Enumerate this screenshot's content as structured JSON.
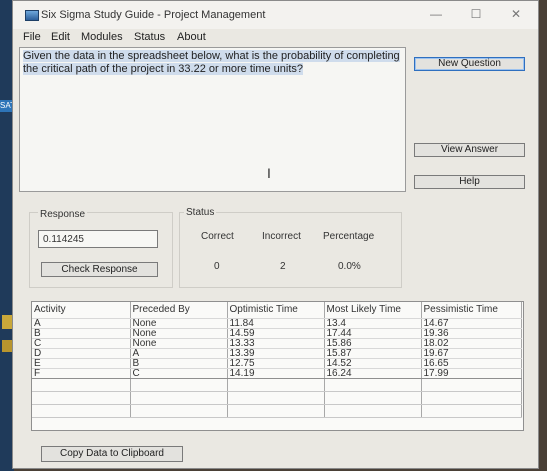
{
  "window": {
    "title": "Six Sigma Study Guide - Project Management"
  },
  "desktop": {
    "label": "SATe"
  },
  "menu": [
    "File",
    "Edit",
    "Modules",
    "Status",
    "About"
  ],
  "question": {
    "line1": "Given the data in the spreadsheet below, what is the probability of completing",
    "line2": "the critical path of the project in 33.22 or more time units?"
  },
  "buttons": {
    "new_question": "New Question",
    "view_answer": "View Answer",
    "help": "Help",
    "check_response": "Check Response",
    "copy_data": "Copy Data to Clipboard"
  },
  "response": {
    "label": "Response",
    "value": "0.114245"
  },
  "status": {
    "label": "Status",
    "headers": [
      "Correct",
      "Incorrect",
      "Percentage"
    ],
    "values": [
      "0",
      "2",
      "0.0%"
    ]
  },
  "table": {
    "headers": [
      "Activity",
      "Preceded By",
      "Optimistic Time",
      "Most Likely Time",
      "Pessimistic Time"
    ],
    "rows": [
      [
        "A",
        "None",
        "11.84",
        "13.4",
        "14.67"
      ],
      [
        "B",
        "None",
        "14.59",
        "17.44",
        "19.36"
      ],
      [
        "C",
        "None",
        "13.33",
        "15.86",
        "18.02"
      ],
      [
        "D",
        "A",
        "13.39",
        "15.87",
        "19.67"
      ],
      [
        "E",
        "B",
        "12.75",
        "14.52",
        "16.65"
      ],
      [
        "F",
        "C",
        "14.19",
        "16.24",
        "17.99"
      ]
    ]
  }
}
